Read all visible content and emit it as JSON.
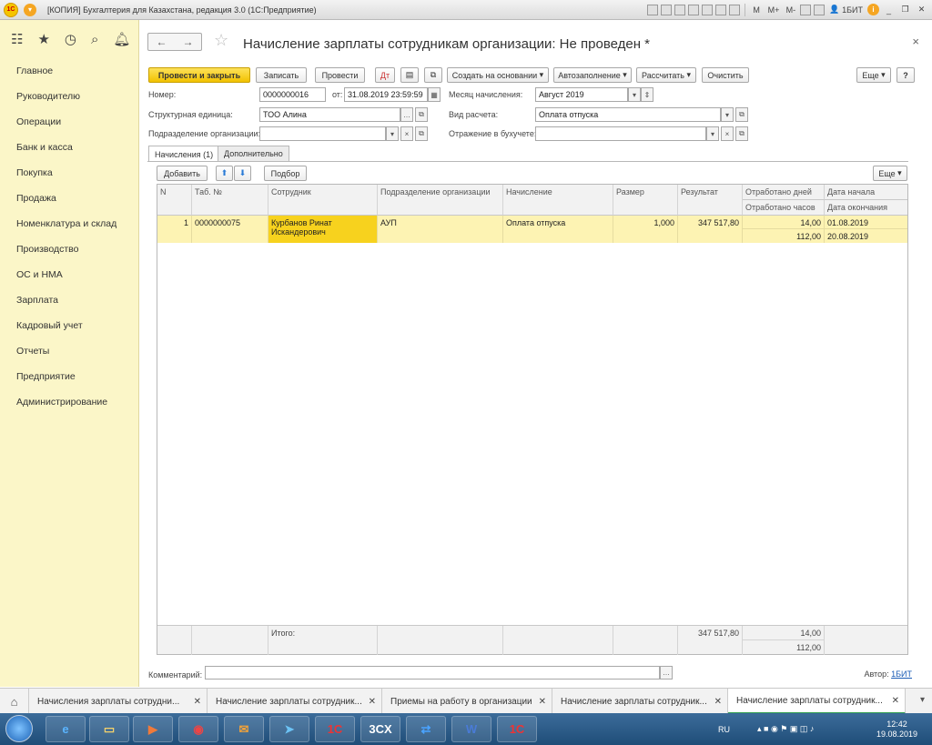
{
  "window": {
    "title": "[КОПИЯ] Бухгалтерия для Казахстана, редакция 3.0  (1С:Предприятие)",
    "logo": "1С",
    "toolbar": [
      "M",
      "M+",
      "M-"
    ],
    "user": "1БИТ"
  },
  "sidebar": {
    "items": [
      "Главное",
      "Руководителю",
      "Операции",
      "Банк и касса",
      "Покупка",
      "Продажа",
      "Номенклатура и склад",
      "Производство",
      "ОС и НМА",
      "Зарплата",
      "Кадровый учет",
      "Отчеты",
      "Предприятие",
      "Администрирование"
    ]
  },
  "doc": {
    "title": "Начисление зарплаты сотрудникам организации: Не проведен *",
    "buttons": {
      "post_close": "Провести и закрыть",
      "save": "Записать",
      "post": "Провести",
      "create_based": "Создать на основании",
      "autofill": "Автозаполнение",
      "calculate": "Рассчитать",
      "clear": "Очистить",
      "more": "Еще",
      "help": "?"
    },
    "fields": {
      "number_label": "Номер:",
      "number": "0000000016",
      "date_label": "от:",
      "date": "31.08.2019 23:59:59",
      "month_label": "Месяц начисления:",
      "month": "Август 2019",
      "unit_label": "Структурная единица:",
      "unit": "ТОО Алина",
      "calc_type_label": "Вид расчета:",
      "calc_type": "Оплата отпуска",
      "division_label": "Подразделение организации:",
      "division": "",
      "accounting_label": "Отражение в бухучете:",
      "accounting": ""
    },
    "tabs": [
      "Начисления (1)",
      "Дополнительно"
    ],
    "table_buttons": {
      "add": "Добавить",
      "select": "Подбор",
      "more": "Еще"
    },
    "table": {
      "headers": {
        "n": "N",
        "tab": "Таб. №",
        "employee": "Сотрудник",
        "division": "Подразделение организации",
        "accrual": "Начисление",
        "size": "Размер",
        "result": "Результат",
        "days": "Отработано дней",
        "hours": "Отработано часов",
        "start": "Дата начала",
        "end": "Дата окончания"
      },
      "rows": [
        {
          "n": "1",
          "tab": "0000000075",
          "employee": "Курбанов Ринат Искандерович",
          "division": "АУП",
          "accrual": "Оплата отпуска",
          "size": "1,000",
          "result": "347 517,80",
          "days": "14,00",
          "hours": "112,00",
          "start": "01.08.2019",
          "end": "20.08.2019"
        }
      ],
      "totals": {
        "label": "Итого:",
        "result": "347 517,80",
        "days": "14,00",
        "hours": "112,00"
      }
    },
    "comment_label": "Комментарий:",
    "author_label": "Автор:",
    "author": "1БИТ"
  },
  "open_windows": [
    "Начисления зарплаты сотрудни...",
    "Начисление зарплаты сотрудник...",
    "Приемы на работу в организации",
    "Начисление зарплаты сотрудник...",
    "Начисление зарплаты сотрудник..."
  ],
  "taskbar": {
    "lang": "RU",
    "time": "12:42",
    "date": "19.08.2019",
    "apps": [
      "ie",
      "explorer",
      "media",
      "chrome",
      "outlook",
      "telegram",
      "1c",
      "3cx",
      "teamviewer",
      "word",
      "1c-alt"
    ]
  }
}
